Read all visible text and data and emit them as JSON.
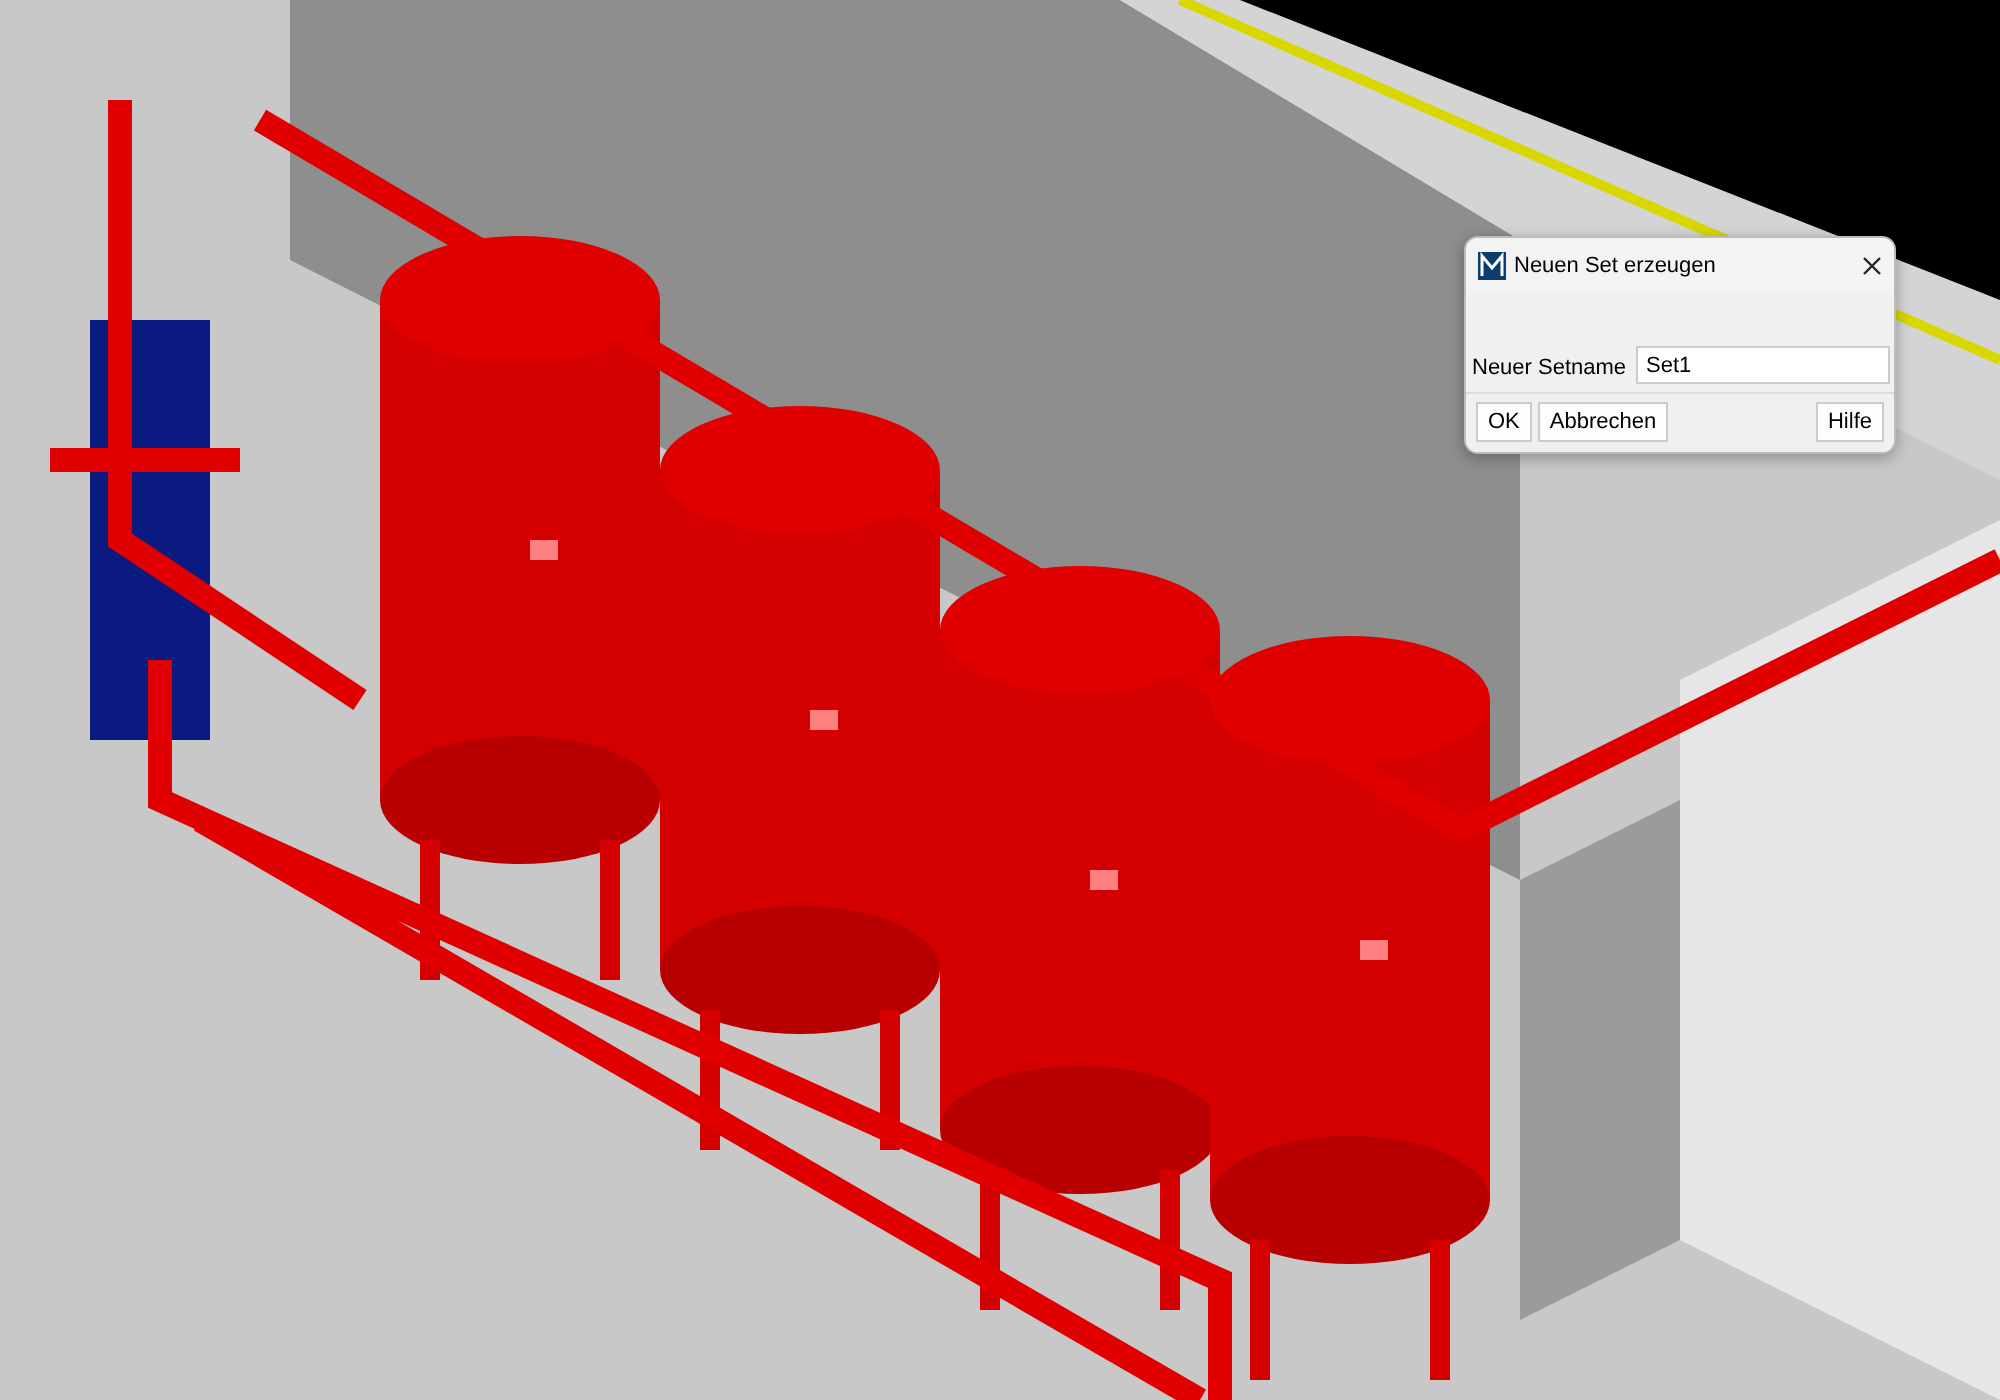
{
  "dialog": {
    "title": "Neuen Set erzeugen",
    "field": {
      "label": "Neuer Setname",
      "value": "Set1"
    },
    "buttons_left": [
      "OK",
      "Abbrechen"
    ],
    "buttons_right": [
      "Hilfe"
    ]
  }
}
